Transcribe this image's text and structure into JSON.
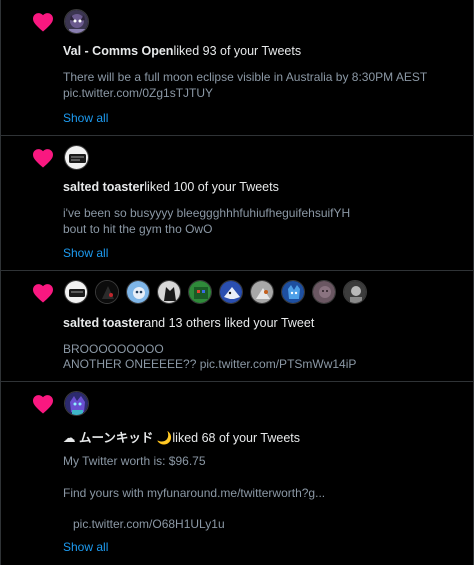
{
  "colors": {
    "background": "#000000",
    "divider": "#2f3336",
    "heart": "#f91880",
    "link": "#1d9bf0",
    "text": "#e7e9ea",
    "muted": "#8b98a5"
  },
  "notifications": [
    {
      "icon": "heart-icon",
      "actor": "Val - Comms Open",
      "action": " liked 93 of your Tweets",
      "lines": [
        "There will be a full moon eclipse visible in Australia by 8:30PM AEST",
        "pic.twitter.com/0Zg1sTJTUY"
      ],
      "show_all": "Show all"
    },
    {
      "icon": "heart-icon",
      "actor": "salted toaster",
      "action": " liked 100 of your Tweets",
      "lines": [
        "i've been so busyyyy bleeggghhhfuhiufheguifehsuifYH",
        "bout to hit the gym tho OwO"
      ],
      "show_all": "Show all"
    },
    {
      "icon": "heart-icon",
      "actor": "salted toaster",
      "action": " and 13 others liked your Tweet",
      "lines": [
        "BROOOOOOOOO",
        "ANOTHER ONEEEEE?? pic.twitter.com/PTSmWw14iP"
      ]
    },
    {
      "icon": "heart-icon",
      "actor": "☁ ムーンキッド 🌙",
      "action": " liked 68 of your Tweets",
      "lines": [
        "My Twitter worth is: $96.75",
        "",
        "Find yours with myfunaround.me/twitterworth?g...",
        "",
        "    pic.twitter.com/O68H1ULy1u"
      ],
      "show_all": "Show all"
    }
  ]
}
